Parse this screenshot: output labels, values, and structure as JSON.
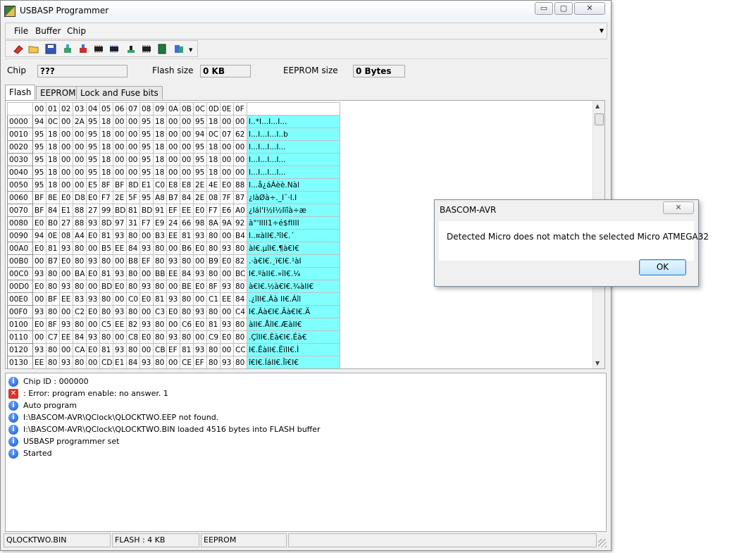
{
  "window": {
    "title": "USBASP Programmer",
    "caption_min": "▭",
    "caption_max": "▢",
    "caption_close": "✕"
  },
  "menu": {
    "file": "File",
    "buffer": "Buffer",
    "chip": "Chip"
  },
  "toolbar": {
    "icons": [
      "erase-icon",
      "open-icon",
      "save-icon",
      "verify-icon",
      "program-icon",
      "read-chip-icon",
      "write-chip-icon",
      "identify-icon",
      "chip-icon",
      "fuse-icon",
      "auto-program-icon",
      "dropdown-icon"
    ]
  },
  "chipbar": {
    "chip_label": "Chip",
    "chip_value": "???",
    "flash_label": "Flash size",
    "flash_value": "0 KB",
    "eeprom_label": "EEPROM size",
    "eeprom_value": "0 Bytes"
  },
  "tabs": [
    "Flash",
    "EEPROM",
    "Lock and Fuse bits"
  ],
  "hex": {
    "columns": [
      "00",
      "01",
      "02",
      "03",
      "04",
      "05",
      "06",
      "07",
      "08",
      "09",
      "0A",
      "0B",
      "0C",
      "0D",
      "0E",
      "0F"
    ],
    "rows": [
      {
        "addr": "0000",
        "bytes": [
          "94",
          "0C",
          "00",
          "2A",
          "95",
          "18",
          "00",
          "00",
          "95",
          "18",
          "00",
          "00",
          "95",
          "18",
          "00",
          "00"
        ],
        "ascii": "I..*I...I...I..."
      },
      {
        "addr": "0010",
        "bytes": [
          "95",
          "18",
          "00",
          "00",
          "95",
          "18",
          "00",
          "00",
          "95",
          "18",
          "00",
          "00",
          "94",
          "0C",
          "07",
          "62"
        ],
        "ascii": "I...I...I...I..b"
      },
      {
        "addr": "0020",
        "bytes": [
          "95",
          "18",
          "00",
          "00",
          "95",
          "18",
          "00",
          "00",
          "95",
          "18",
          "00",
          "00",
          "95",
          "18",
          "00",
          "00"
        ],
        "ascii": "I...I...I...I..."
      },
      {
        "addr": "0030",
        "bytes": [
          "95",
          "18",
          "00",
          "00",
          "95",
          "18",
          "00",
          "00",
          "95",
          "18",
          "00",
          "00",
          "95",
          "18",
          "00",
          "00"
        ],
        "ascii": "I...I...I...I..."
      },
      {
        "addr": "0040",
        "bytes": [
          "95",
          "18",
          "00",
          "00",
          "95",
          "18",
          "00",
          "00",
          "95",
          "18",
          "00",
          "00",
          "95",
          "18",
          "00",
          "00"
        ],
        "ascii": "I...I...I...I..."
      },
      {
        "addr": "0050",
        "bytes": [
          "95",
          "18",
          "00",
          "00",
          "E5",
          "8F",
          "BF",
          "8D",
          "E1",
          "C0",
          "E8",
          "E8",
          "2E",
          "4E",
          "E0",
          "88"
        ],
        "ascii": "I...å¿áÀèè.Nàl"
      },
      {
        "addr": "0060",
        "bytes": [
          "BF",
          "8E",
          "E0",
          "D8",
          "E0",
          "F7",
          "2E",
          "5F",
          "95",
          "A8",
          "B7",
          "84",
          "2E",
          "08",
          "7F",
          "87"
        ],
        "ascii": "¿làØà÷._I¨·I.I"
      },
      {
        "addr": "0070",
        "bytes": [
          "BF",
          "84",
          "E1",
          "88",
          "27",
          "99",
          "BD",
          "81",
          "BD",
          "91",
          "EF",
          "EE",
          "E0",
          "F7",
          "E6",
          "A0"
        ],
        "ascii": "¿Iál'I½I½Iïîà÷æ"
      },
      {
        "addr": "0080",
        "bytes": [
          "E0",
          "B0",
          "27",
          "88",
          "93",
          "8D",
          "97",
          "31",
          "F7",
          "E9",
          "24",
          "66",
          "98",
          "8A",
          "9A",
          "92"
        ],
        "ascii": "à°'IIII1÷é$fIIII"
      },
      {
        "addr": "0090",
        "bytes": [
          "94",
          "0E",
          "08",
          "A4",
          "E0",
          "81",
          "93",
          "80",
          "00",
          "B3",
          "EE",
          "81",
          "93",
          "80",
          "00",
          "B4"
        ],
        "ascii": "I..¤àII€.³îI€.´"
      },
      {
        "addr": "00A0",
        "bytes": [
          "E0",
          "81",
          "93",
          "80",
          "00",
          "B5",
          "EE",
          "84",
          "93",
          "80",
          "00",
          "B6",
          "E0",
          "80",
          "93",
          "80"
        ],
        "ascii": "àI€.µîI€.¶à€I€"
      },
      {
        "addr": "00B0",
        "bytes": [
          "00",
          "B7",
          "E0",
          "80",
          "93",
          "80",
          "00",
          "B8",
          "EF",
          "80",
          "93",
          "80",
          "00",
          "B9",
          "E0",
          "82"
        ],
        "ascii": ".·à€I€.¸ï€I€.¹àI"
      },
      {
        "addr": "00C0",
        "bytes": [
          "93",
          "80",
          "00",
          "BA",
          "E0",
          "81",
          "93",
          "80",
          "00",
          "BB",
          "EE",
          "84",
          "93",
          "80",
          "00",
          "BC"
        ],
        "ascii": "I€.ºàII€.»îI€.¼"
      },
      {
        "addr": "00D0",
        "bytes": [
          "E0",
          "80",
          "93",
          "80",
          "00",
          "BD",
          "E0",
          "80",
          "93",
          "80",
          "00",
          "BE",
          "E0",
          "8F",
          "93",
          "80"
        ],
        "ascii": "à€I€.½à€I€.¾àII€"
      },
      {
        "addr": "00E0",
        "bytes": [
          "00",
          "BF",
          "EE",
          "83",
          "93",
          "80",
          "00",
          "C0",
          "E0",
          "81",
          "93",
          "80",
          "00",
          "C1",
          "EE",
          "84"
        ],
        "ascii": ".¿îII€.Àà II€.Áîl"
      },
      {
        "addr": "00F0",
        "bytes": [
          "93",
          "80",
          "00",
          "C2",
          "E0",
          "80",
          "93",
          "80",
          "00",
          "C3",
          "E0",
          "80",
          "93",
          "80",
          "00",
          "C4"
        ],
        "ascii": "I€.Âà€I€.Ãà€I€.Ä"
      },
      {
        "addr": "0100",
        "bytes": [
          "E0",
          "8F",
          "93",
          "80",
          "00",
          "C5",
          "EE",
          "82",
          "93",
          "80",
          "00",
          "C6",
          "E0",
          "81",
          "93",
          "80"
        ],
        "ascii": "àII€.ÅîI€.ÆàII€"
      },
      {
        "addr": "0110",
        "bytes": [
          "00",
          "C7",
          "EE",
          "84",
          "93",
          "80",
          "00",
          "C8",
          "E0",
          "80",
          "93",
          "80",
          "00",
          "C9",
          "E0",
          "80"
        ],
        "ascii": ".ÇîII€.Èà€I€.Éà€"
      },
      {
        "addr": "0120",
        "bytes": [
          "93",
          "80",
          "00",
          "CA",
          "E0",
          "81",
          "93",
          "80",
          "00",
          "CB",
          "EF",
          "81",
          "93",
          "80",
          "00",
          "CC"
        ],
        "ascii": "I€.ÊàII€.ËïII€.Ì"
      },
      {
        "addr": "0130",
        "bytes": [
          "EE",
          "80",
          "93",
          "80",
          "00",
          "CD",
          "E1",
          "84",
          "93",
          "80",
          "00",
          "CE",
          "EF",
          "80",
          "93",
          "80"
        ],
        "ascii": "î€I€.ÍáII€.Îï€I€"
      }
    ]
  },
  "log": [
    {
      "type": "info",
      "text": "Chip ID : 000000"
    },
    {
      "type": "error",
      "text": ": Error: program enable: no answer. 1"
    },
    {
      "type": "info",
      "text": "Auto program"
    },
    {
      "type": "info",
      "text": "I:\\BASCOM-AVR\\QClock\\QLOCKTWO.EEP not found."
    },
    {
      "type": "info",
      "text": "I:\\BASCOM-AVR\\QClock\\QLOCKTWO.BIN loaded 4516 bytes into FLASH buffer"
    },
    {
      "type": "info",
      "text": "USBASP programmer set"
    },
    {
      "type": "info",
      "text": "Started"
    }
  ],
  "status": {
    "file": "QLOCKTWO.BIN",
    "flash": "FLASH : 4 KB",
    "eeprom": "EEPROM",
    "extra": ""
  },
  "dialog": {
    "title": "BASCOM-AVR",
    "close": "✕",
    "message": "Detected Micro  does not match the selected Micro ATMEGA32",
    "ok": "OK"
  }
}
